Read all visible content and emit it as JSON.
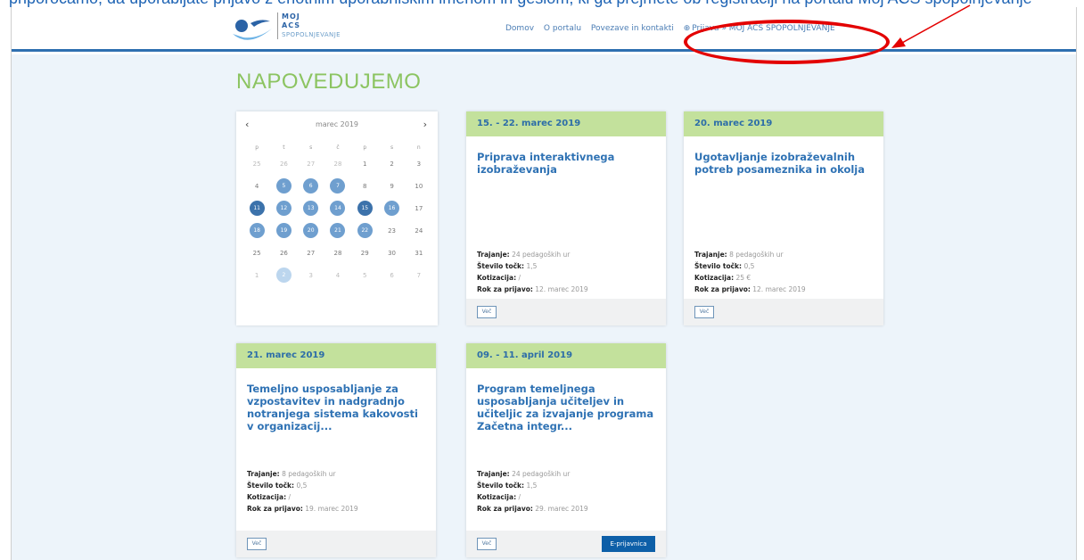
{
  "top_strip_text": "priporočamo, da uporabljate prijavo z enotnim uporabniškim imenom in geslom, ki ga prejmete ob registraciji na portalu Moj ACS spopolnjevanje",
  "logo": {
    "line1": "MOJ",
    "line2": "ACS",
    "line3": "SPOPOLNJEVANJE"
  },
  "nav": {
    "items": [
      "Domov",
      "O portalu",
      "Povezave in kontakti"
    ],
    "login": "Prijava » MOJ ACS SPOPOLNJEVANJE"
  },
  "page_title": "NAPOVEDUJEMO",
  "calendar": {
    "month": "marec 2019",
    "weekdays": [
      "p",
      "t",
      "s",
      "č",
      "p",
      "s",
      "n"
    ],
    "weeks": [
      [
        {
          "d": "25",
          "t": "dim"
        },
        {
          "d": "26",
          "t": "dim"
        },
        {
          "d": "27",
          "t": "dim"
        },
        {
          "d": "28",
          "t": "dim"
        },
        {
          "d": "1",
          "t": ""
        },
        {
          "d": "2",
          "t": ""
        },
        {
          "d": "3",
          "t": ""
        }
      ],
      [
        {
          "d": "4",
          "t": ""
        },
        {
          "d": "5",
          "t": "dot"
        },
        {
          "d": "6",
          "t": "dot"
        },
        {
          "d": "7",
          "t": "dot"
        },
        {
          "d": "8",
          "t": ""
        },
        {
          "d": "9",
          "t": ""
        },
        {
          "d": "10",
          "t": ""
        }
      ],
      [
        {
          "d": "11",
          "t": "dark"
        },
        {
          "d": "12",
          "t": "dot"
        },
        {
          "d": "13",
          "t": "dot"
        },
        {
          "d": "14",
          "t": "dot"
        },
        {
          "d": "15",
          "t": "dark"
        },
        {
          "d": "16",
          "t": "dot"
        },
        {
          "d": "17",
          "t": ""
        }
      ],
      [
        {
          "d": "18",
          "t": "dot"
        },
        {
          "d": "19",
          "t": "dot"
        },
        {
          "d": "20",
          "t": "dot"
        },
        {
          "d": "21",
          "t": "dot"
        },
        {
          "d": "22",
          "t": "dot"
        },
        {
          "d": "23",
          "t": ""
        },
        {
          "d": "24",
          "t": ""
        }
      ],
      [
        {
          "d": "25",
          "t": ""
        },
        {
          "d": "26",
          "t": ""
        },
        {
          "d": "27",
          "t": ""
        },
        {
          "d": "28",
          "t": ""
        },
        {
          "d": "29",
          "t": ""
        },
        {
          "d": "30",
          "t": ""
        },
        {
          "d": "31",
          "t": ""
        }
      ],
      [
        {
          "d": "1",
          "t": "dim"
        },
        {
          "d": "2",
          "t": "light"
        },
        {
          "d": "3",
          "t": "dim"
        },
        {
          "d": "4",
          "t": "dim"
        },
        {
          "d": "5",
          "t": "dim"
        },
        {
          "d": "6",
          "t": "dim"
        },
        {
          "d": "7",
          "t": "dim"
        }
      ]
    ]
  },
  "labels": {
    "duration": "Trajanje:",
    "points": "Število točk:",
    "fee": "Kotizacija:",
    "deadline": "Rok za prijavo:",
    "more": "Več",
    "apply": "E-prijavnica"
  },
  "cards": [
    {
      "date": "15. - 22. marec 2019",
      "title": "Priprava interaktivnega izobraževanja",
      "duration": "24 pedagoških ur",
      "points": "1,5",
      "fee": "/",
      "deadline": "12. marec 2019"
    },
    {
      "date": "20. marec 2019",
      "title": "Ugotavljanje izobraževalnih potreb posameznika in okolja",
      "duration": "8 pedagoških ur",
      "points": "0,5",
      "fee": "25 €",
      "deadline": "12. marec 2019"
    },
    {
      "date": "21. marec 2019",
      "title": "Temeljno usposabljanje za vzpostavitev in nadgradnjo notranjega sistema kakovosti v organizacij...",
      "duration": "8 pedagoških ur",
      "points": "0,5",
      "fee": "/",
      "deadline": "19. marec 2019"
    },
    {
      "date": "09. - 11. april 2019",
      "title": "Program temeljnega usposabljanja učiteljev in učiteljic za izvajanje programa Začetna integr...",
      "duration": "24 pedagoških ur",
      "points": "1,5",
      "fee": "/",
      "deadline": "29. marec 2019"
    }
  ],
  "colors": {
    "accent_green": "#8cc461",
    "card_header": "#c3e19c",
    "link_blue": "#2f72b4",
    "annotation_red": "#e30000"
  }
}
